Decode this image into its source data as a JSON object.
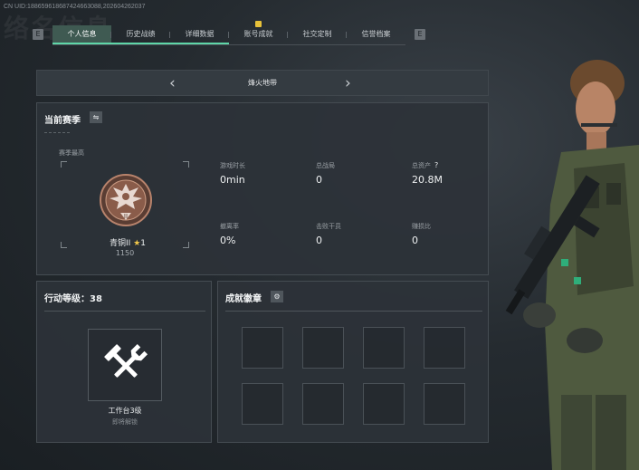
{
  "header": {
    "uid_text": "CN UID:188659618687424663088,202604262037",
    "ghost_title": "络名信息"
  },
  "nav": {
    "prev_key": "E",
    "next_key": "E",
    "badge_glyph": "!",
    "tabs": [
      {
        "label": "个人信息",
        "active": true
      },
      {
        "label": "历史战绩",
        "active": false
      },
      {
        "label": "详细数据",
        "active": false
      },
      {
        "label": "账号成就",
        "active": false
      },
      {
        "label": "社交定制",
        "active": false
      },
      {
        "label": "信誉档案",
        "active": false
      }
    ]
  },
  "map_selector": {
    "name": "烽火地带",
    "prev_glyph": "‹",
    "next_glyph": "›"
  },
  "season": {
    "title": "当前赛季",
    "toggle_glyph": "⇋",
    "peak_label": "赛季最高",
    "rank_name": "青铜II",
    "rank_stars": "1",
    "rank_numeral": "II",
    "rank_score": "1150",
    "stats": [
      {
        "label": "游戏时长",
        "value": "0min"
      },
      {
        "label": "总战局",
        "value": "0"
      },
      {
        "label": "总资产",
        "value": "20.8M",
        "hint": "?"
      },
      {
        "label": "撤离率",
        "value": "0%"
      },
      {
        "label": "击败干员",
        "value": "0"
      },
      {
        "label": "赚损比",
        "value": "0"
      }
    ]
  },
  "level": {
    "title": "行动等级：38",
    "tool_name": "工作台3级",
    "tool_status": "即将解锁",
    "tool_icon": "hammer-wrench-icon"
  },
  "badges": {
    "title": "成就徽章",
    "settings_icon": "gear-icon",
    "slot_count": 8
  },
  "colors": {
    "accent": "#5fd6a8",
    "rank_bronze": "#9a6a55",
    "star": "#f0c74a"
  }
}
